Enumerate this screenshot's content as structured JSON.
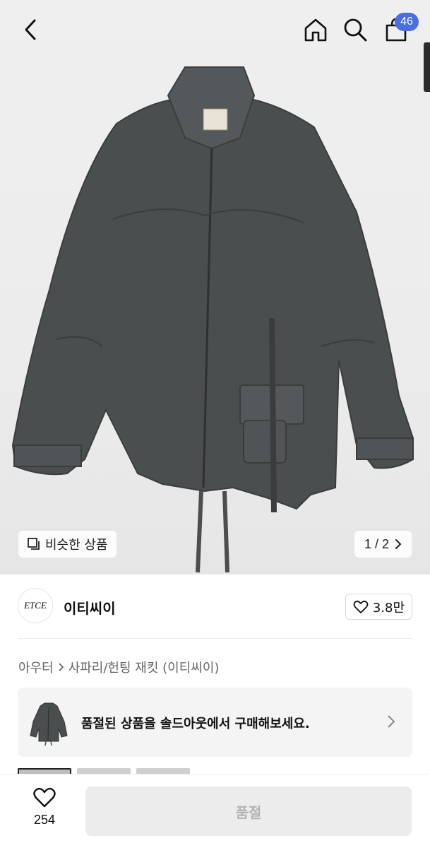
{
  "header": {
    "cart_count": "46",
    "icons": [
      "back-arrow-icon",
      "home-icon",
      "search-icon",
      "shopping-bag-icon"
    ]
  },
  "gallery": {
    "similar_label": "비슷한 상품",
    "page_indicator": "1 / 2"
  },
  "brand": {
    "logo_text": "ETCE",
    "name": "이티씨이",
    "likes": "3.8만"
  },
  "breadcrumb": {
    "category": "아우터",
    "subcategory": "사파리/헌팅 재킷 (이티씨이)"
  },
  "soldout_banner": {
    "message": "품절된 상품을 솔드아웃에서 구매해보세요."
  },
  "bottom_bar": {
    "wish_count": "254",
    "buy_label": "품절"
  },
  "colors": {
    "badge": "#4a6ee0",
    "jacket": "#4b4e4f",
    "disabled_button": "#ececec"
  }
}
